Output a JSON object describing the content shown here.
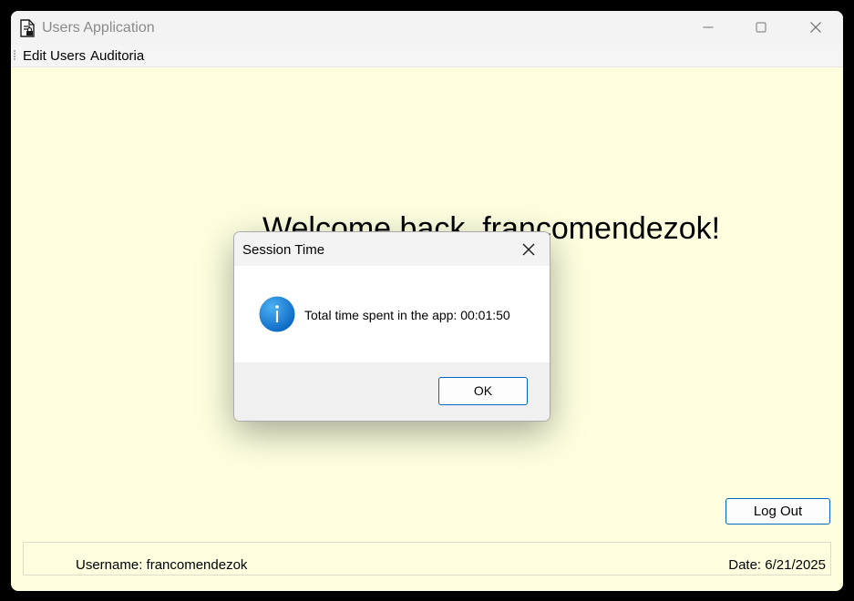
{
  "window": {
    "title": "Users Application",
    "icon": "document-lock-icon"
  },
  "titlebar_buttons": [
    "minimize-icon",
    "maximize-icon",
    "close-icon"
  ],
  "menu": {
    "items": [
      {
        "label": "Edit Users"
      },
      {
        "label": "Auditoria"
      }
    ]
  },
  "main": {
    "welcome": "Welcome back, francomendezok!",
    "logout_label": "Log Out"
  },
  "status": {
    "username": "Username: francomendezok",
    "date": "Date: 6/21/2025"
  },
  "dialog": {
    "title": "Session Time",
    "icon": "info-icon",
    "message": "Total time spent in the app: 00:01:50",
    "ok_label": "OK"
  },
  "colors": {
    "window_bg": "#ffffe0",
    "accent": "#0067c0",
    "info_blue": "#1a7fd4"
  }
}
